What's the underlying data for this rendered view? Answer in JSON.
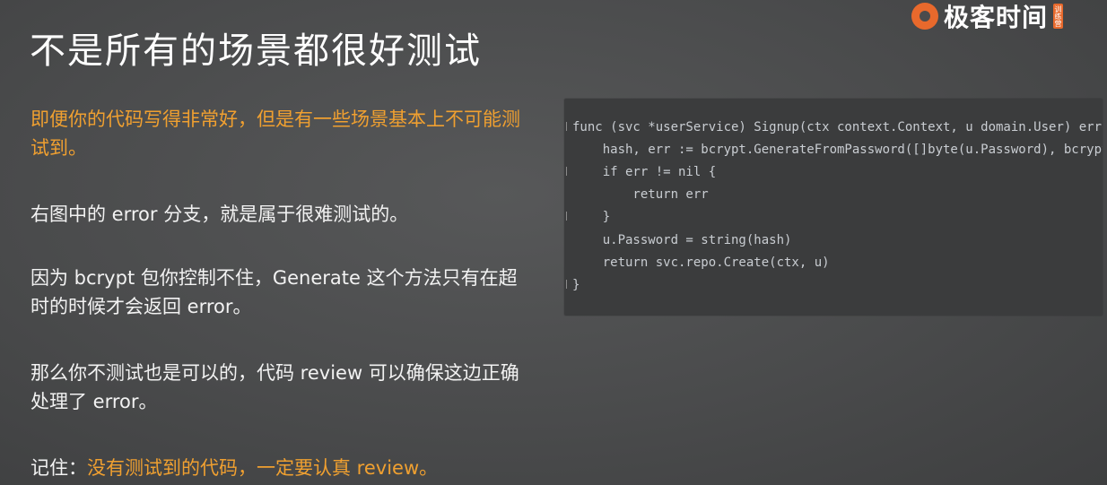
{
  "slide": {
    "title": "不是所有的场景都很好测试",
    "logo_text": "极客时间",
    "logo_badge": "训练营"
  },
  "paragraphs": [
    {
      "text": "即便你的代码写得非常好，但是有一些场景基本上不可能测试到。"
    },
    {
      "text": "右图中的 error 分支，就是属于很难测试的。"
    },
    {
      "text": "因为 bcrypt 包你控制不住，Generate 这个方法只有在超时的时候才会返回 error。"
    },
    {
      "text": "那么你不测试也是可以的，代码 review 可以确保这边正确处理了 error。"
    },
    {
      "prefix": "记住：",
      "highlight": "没有测试到的代码，一定要认真 review。"
    }
  ],
  "code": {
    "lines": [
      "func (svc *userService) Signup(ctx context.Context, u domain.User) error {",
      "    hash, err := bcrypt.GenerateFromPassword([]byte(u.Password), bcrypt.DefaultCost)",
      "    if err != nil {",
      "        return err",
      "    }",
      "    u.Password = string(hash)",
      "    return svc.repo.Create(ctx, u)",
      "}"
    ]
  },
  "colors": {
    "accent_orange": "#f0a030",
    "logo_orange": "#e8692c",
    "background": "#4a4b4c",
    "code_background": "#3b3c3d"
  }
}
